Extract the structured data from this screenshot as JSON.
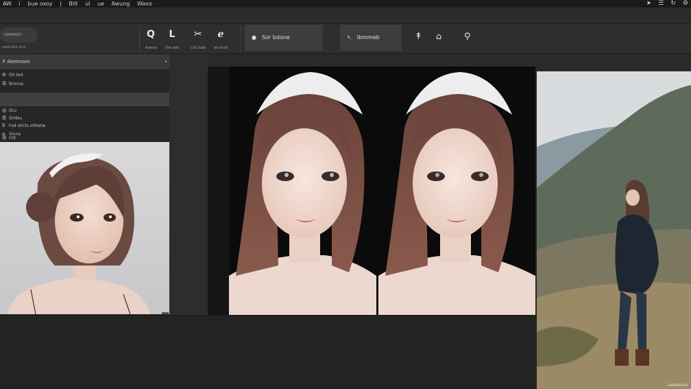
{
  "titlebar": {
    "items": [
      "AW",
      "i",
      "bue oxoy",
      "|",
      "Blit",
      "ul",
      "ue",
      "Awung",
      "Wavo"
    ],
    "icons": [
      "arrow-icon",
      "menu-icon",
      "refresh-icon",
      "settings-icon"
    ]
  },
  "toolbar": {
    "search_label": "commcn",
    "search_sub": "nsbd ahd ssvs",
    "tools": [
      {
        "glyph": "Q",
        "label": "Inanvd"
      },
      {
        "glyph": "L",
        "label": "Drb aob"
      },
      {
        "glyph": "✂",
        "label": "Crh Sutb"
      },
      {
        "glyph": "ℯ",
        "label": "ell dvsd"
      }
    ],
    "primary_button": "Sor bdone",
    "secondary_button": "Ibmmeb",
    "secondary_glyph": "↖",
    "extra_icons": [
      "↟",
      "⌂",
      "⚲"
    ]
  },
  "left_panel": {
    "header": "F  Alemnom",
    "rows": [
      {
        "icon": "⊖",
        "label": "Dit ted"
      },
      {
        "icon": "☰",
        "label": "Brnnus"
      },
      {
        "icon": "",
        "label": ""
      },
      {
        "icon": "◎",
        "label": "Dru"
      },
      {
        "icon": "☰",
        "label": "Srtdes"
      },
      {
        "icon": "S",
        "label": "Fsd ulrcts  otlhetw"
      },
      {
        "icon": "⌂",
        "label": "Viuna"
      },
      {
        "icon": "☰",
        "label": "Cht"
      }
    ]
  },
  "landscape": {
    "caption": "Lemanunr"
  },
  "colors": {
    "app_bg": "#262626",
    "toolbar_bg": "#2e2e2e",
    "panel_header": "#3a3a3a",
    "selected_row": "#404040",
    "button_bg": "#3d3d3d",
    "canvas_black": "#0d0d0d"
  }
}
